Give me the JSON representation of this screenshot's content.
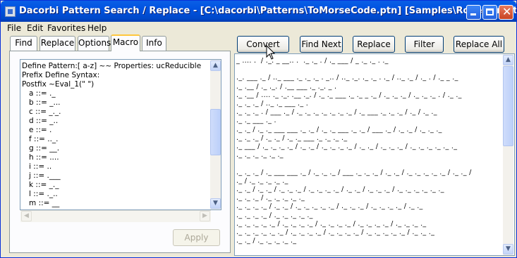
{
  "window": {
    "title": "Dacorbi Pattern Search / Replace - [C:\\dacorbi\\Patterns\\ToMorseCode.ptn] [Samples\\RobertFrost.txt]",
    "minimize_icon": "minimize-icon",
    "maximize_icon": "maximize-icon",
    "close_icon": "close-icon",
    "close_glyph": "✕"
  },
  "menu": [
    "File",
    "Edit",
    "Favorites",
    "Help"
  ],
  "tabs": [
    "Find",
    "Replace",
    "Options",
    "Macro",
    "Info"
  ],
  "active_tab": "Macro",
  "macro_lines": [
    "Define Pattern:[ a-z] ~~ Properties: ucReducible",
    "Prefix Define Syntax:",
    "Postfix ~Eval_1(\" \")",
    "   a ::= ._",
    "   b ::= _...",
    "   c ::= _._.",
    "   d ::= _..",
    "   e ::= .",
    "   f ::= .._.",
    "   g ::= __.",
    "   h ::= ....",
    "   i ::= ..",
    "   j ::= .___",
    "   k ::= _._",
    "   l ::= ._..",
    "   m ::= __"
  ],
  "apply_label": "Apply",
  "actions": [
    "Convert",
    "Find Next",
    "Replace",
    "Filter",
    "Replace All"
  ],
  "output_lines": [
    "_ .... .  / ._. _ __.. .  ._ ._ . / ._ ___ / _ ._ ._ . ._",
    "",
    "._. ___ ._ / .._ ___ ._ ._ ._ . _.. / .._ ._. ._ ._ . ._ / .._ ._ / ._ . / ._ _ ._",
    "._ .__ / ._ ._. / .__ ___ ._ ._. _ .",
    "._ .__ / .... ._ ._. .__ ._. / ._ ._ ___ ._ ._ _ ._ / ._ ._ ._ / ._ ._ ._ . / ._ ._",
    "._ ._ ._ / .._ ._ ___ ._ .",
    "._ ._ ._ . / ___ ._ / ._ ._ ._ ._ ._ ._ ._ / ._ ___ ._ ._ ._ / ._ / ._ ._",
    "._ ._ ___ ._ .",
    "._ ._ / ._ ._ ___ ___ ._ ._ / ._ ._ ___ ._ ._ / ___ ._ / ._ ._ / ._ ._ ._",
    "._ ._ ._ / ._ ._ / ._ ._ ___ ._ ._ ._ ._",
    "._ ___ / ._ ._ ._ ._ / ._ ._ / ._ ._ ._ ._ / ._ ._ / ._ ._ ._ / ._ ._ ._ ._ ._ ._",
    "._ ._ ._ ._ ._ ._",
    "",
    "._ ._ ._ / ._ ___ ___ ._ / ._ ._ ._ / ___ ._ ._ ._ / ._ ._ / ._ ._ ._ ._ ._ / ._ ._ /",
    "._ / ._ ._ ._ ._ ._",
    "._ ._ / ._ ._ / ._ ._ ._ / ._ ._ ._ ._ / ._ ._ / ._ ._ ._ / ._ ._ ._ ._ ._ ._",
    "._ ._ ._ / ._ ._ ._ ._ ._",
    "._ ._ ._ ._ / ._ ._ / ._ ._ ._ ._ ._ / ._ ._ ._ / ._ ._ ._ ._ / ._ ._",
    "._ ._ ._ ._ / ._ ._ ._ ._ ._",
    "._ ._ ._ ._ ._ / ._ ._ ._ ._ / ._ ._ ._ ._ / ._ ._ ._ ._ / ._ ._ ._ ._",
    "._ ._ ._ ._ ._ ._ / ._ ._ ._ ._ / ._ ._ ._ ._ / ._ ._ ._ ._ ._ / ._ ._ ._",
    "._ ._ / ._ ._ ._ ._ ._"
  ]
}
